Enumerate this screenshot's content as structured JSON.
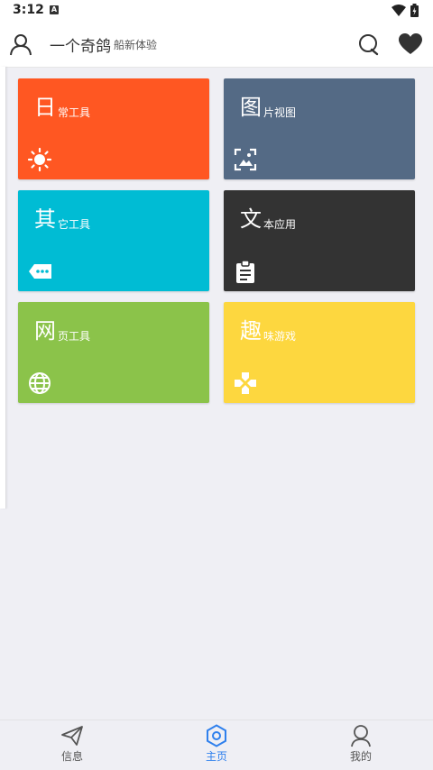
{
  "status": {
    "time": "3:12",
    "notification_glyph": "A"
  },
  "header": {
    "title": "一个奇鸽",
    "subtitle": "船新体验"
  },
  "tiles": [
    {
      "big": "日",
      "rest": "常工具",
      "color": "#ff5722",
      "icon": "sun-icon"
    },
    {
      "big": "图",
      "rest": "片视图",
      "color": "#546a85",
      "icon": "image-icon"
    },
    {
      "big": "其",
      "rest": "它工具",
      "color": "#00bcd4",
      "icon": "tag-icon"
    },
    {
      "big": "文",
      "rest": "本应用",
      "color": "#333333",
      "icon": "clipboard-icon"
    },
    {
      "big": "网",
      "rest": "页工具",
      "color": "#8bc34a",
      "icon": "globe-icon"
    },
    {
      "big": "趣",
      "rest": "味游戏",
      "color": "#fdd73f",
      "icon": "gamepad-icon"
    }
  ],
  "nav": [
    {
      "label": "信息",
      "icon": "send-icon"
    },
    {
      "label": "主页",
      "icon": "home-hexagon-icon",
      "active": true
    },
    {
      "label": "我的",
      "icon": "profile-icon"
    }
  ],
  "colors": {
    "accent": "#2f80ed",
    "background": "#efeff4"
  }
}
